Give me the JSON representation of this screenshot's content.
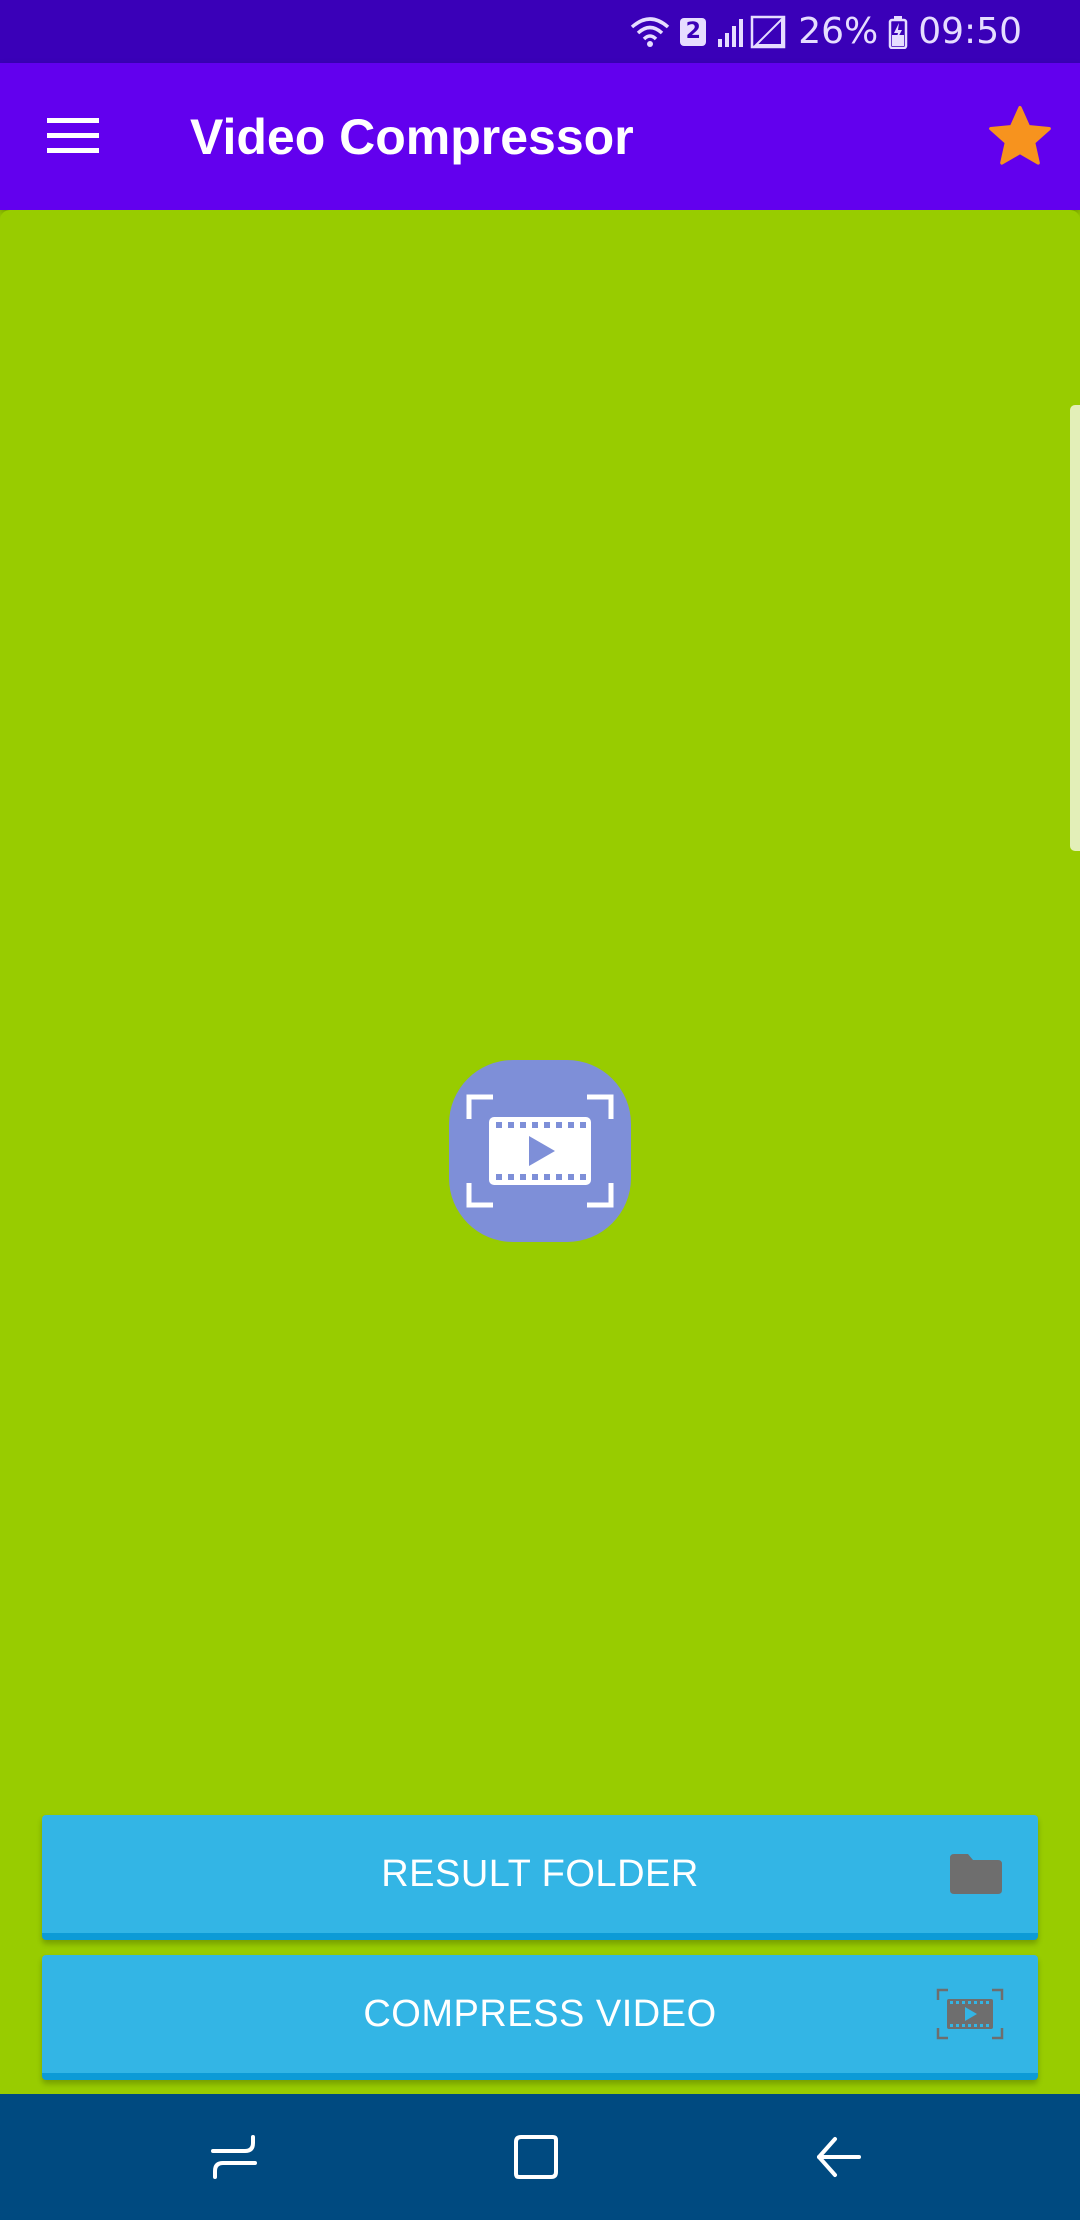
{
  "status_bar": {
    "wifi_icon": "wifi-icon",
    "sim_badge": "2",
    "signal_icon": "signal-icon",
    "battery_percent": "26%",
    "battery_icon": "battery-charging-icon",
    "time": "09:50"
  },
  "app_bar": {
    "menu_icon": "hamburger-menu-icon",
    "title": "Video Compressor",
    "star_icon": "star-icon"
  },
  "main": {
    "center_icon": "video-frame-icon"
  },
  "buttons": {
    "result_folder": {
      "label": "RESULT FOLDER",
      "icon": "folder-icon"
    },
    "compress_video": {
      "label": "COMPRESS VIDEO",
      "icon": "video-frame-icon"
    }
  },
  "nav_bar": {
    "recents_icon": "recents-icon",
    "home_icon": "home-icon",
    "back_icon": "back-icon"
  },
  "colors": {
    "status_bar": "#3a00b8",
    "app_bar": "#6200ee",
    "content_background": "#98cc00",
    "button": "#33b5e5",
    "star": "#f7931e",
    "center_tile": "#7e8fd8",
    "nav_bar": "#004a80"
  }
}
